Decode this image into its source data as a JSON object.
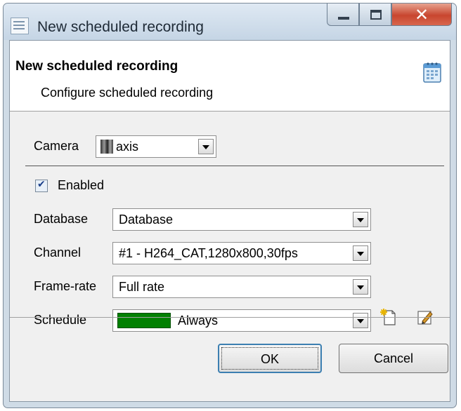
{
  "window": {
    "title": "New scheduled recording"
  },
  "header": {
    "title": "New scheduled recording",
    "subtitle": "Configure scheduled recording"
  },
  "form": {
    "camera": {
      "label": "Camera",
      "value": "axis"
    },
    "enabled": {
      "label": "Enabled",
      "checked": true
    },
    "database": {
      "label": "Database",
      "value": "Database"
    },
    "channel": {
      "label": "Channel",
      "value": "#1 - H264_CAT,1280x800,30fps"
    },
    "framerate": {
      "label": "Frame-rate",
      "value": "Full rate"
    },
    "schedule": {
      "label": "Schedule",
      "value": "Always",
      "color": "#008000"
    }
  },
  "buttons": {
    "ok": "OK",
    "cancel": "Cancel"
  },
  "icons": {
    "app": "window-icon",
    "header": "calendar-icon",
    "schedule_new": "new-item-icon",
    "schedule_edit": "edit-pencil-icon"
  }
}
